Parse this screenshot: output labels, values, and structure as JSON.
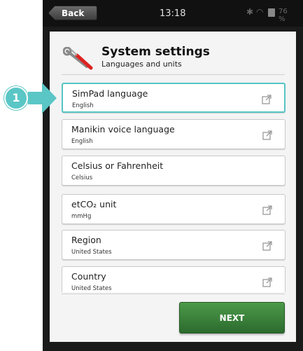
{
  "status_bar": {
    "back_label": "Back",
    "time": "13:18",
    "battery_percent": "76 %"
  },
  "header": {
    "title": "System settings",
    "subtitle": "Languages and units"
  },
  "settings": [
    {
      "label": "SimPad language",
      "value": "English",
      "has_link_icon": true
    },
    {
      "label": "Manikin voice language",
      "value": "English",
      "has_link_icon": true
    },
    {
      "label": "Celsius or Fahrenheit",
      "value": "Celsius",
      "has_link_icon": false
    },
    {
      "label": "etCO₂ unit",
      "value": "mmHg",
      "has_link_icon": true
    },
    {
      "label": "Region",
      "value": "United States",
      "has_link_icon": true
    },
    {
      "label": "Country",
      "value": "United States",
      "has_link_icon": true
    }
  ],
  "callout": {
    "number": "1"
  },
  "next_button": {
    "label": "NEXT"
  },
  "colors": {
    "accent": "#5bc6c6",
    "next_button": "#3f8a3d",
    "frame": "#1a1a1a"
  }
}
